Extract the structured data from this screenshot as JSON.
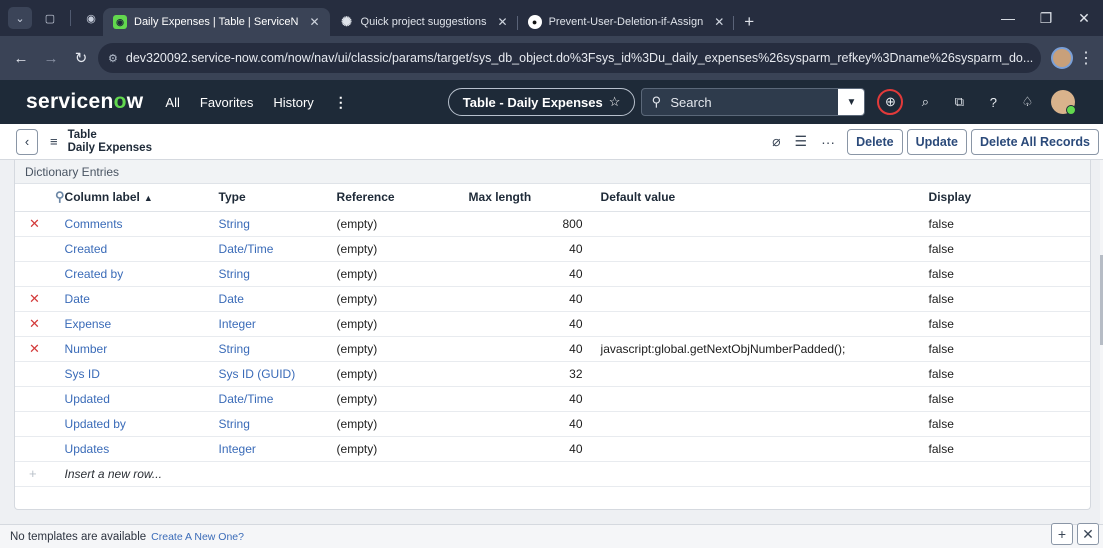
{
  "browser": {
    "tabs": [
      {
        "title": "Daily Expenses | Table | ServiceN",
        "active": true,
        "icon": "servicenow-icon"
      },
      {
        "title": "Quick project suggestions",
        "active": false,
        "icon": "chatgpt-icon"
      },
      {
        "title": "Prevent-User-Deletion-if-Assign",
        "active": false,
        "icon": "github-icon"
      }
    ],
    "new_tab": "+",
    "url": "dev320092.service-now.com/now/nav/ui/classic/params/target/sys_db_object.do%3Fsys_id%3Du_daily_expenses%26sysparm_refkey%3Dname%26sysparm_do..."
  },
  "header": {
    "logo_a": "servicen",
    "logo_o": "o",
    "logo_b": "w",
    "menu": {
      "all": "All",
      "favorites": "Favorites",
      "history": "History",
      "more": "⋮"
    },
    "context_pill": "Table - Daily Expenses",
    "search_placeholder": "Search"
  },
  "form": {
    "title_line1": "Table",
    "title_line2": "Daily Expenses",
    "buttons": {
      "delete": "Delete",
      "update": "Update",
      "delete_all": "Delete All Records"
    }
  },
  "related_list": {
    "title": "Dictionary Entries",
    "columns": {
      "label": "Column label",
      "type": "Type",
      "reference": "Reference",
      "max_length": "Max length",
      "default_value": "Default value",
      "display": "Display"
    },
    "rows": [
      {
        "deletable": true,
        "label": "Comments",
        "type": "String",
        "reference": "(empty)",
        "max_length": "800",
        "default_value": "",
        "display": "false"
      },
      {
        "deletable": false,
        "label": "Created",
        "type": "Date/Time",
        "reference": "(empty)",
        "max_length": "40",
        "default_value": "",
        "display": "false"
      },
      {
        "deletable": false,
        "label": "Created by",
        "type": "String",
        "reference": "(empty)",
        "max_length": "40",
        "default_value": "",
        "display": "false"
      },
      {
        "deletable": true,
        "label": "Date",
        "type": "Date",
        "reference": "(empty)",
        "max_length": "40",
        "default_value": "",
        "display": "false"
      },
      {
        "deletable": true,
        "label": "Expense",
        "type": "Integer",
        "reference": "(empty)",
        "max_length": "40",
        "default_value": "",
        "display": "false"
      },
      {
        "deletable": true,
        "label": "Number",
        "type": "String",
        "reference": "(empty)",
        "max_length": "40",
        "default_value": "javascript:global.getNextObjNumberPadded();",
        "display": "false"
      },
      {
        "deletable": false,
        "label": "Sys ID",
        "type": "Sys ID (GUID)",
        "reference": "(empty)",
        "max_length": "32",
        "default_value": "",
        "display": "false"
      },
      {
        "deletable": false,
        "label": "Updated",
        "type": "Date/Time",
        "reference": "(empty)",
        "max_length": "40",
        "default_value": "",
        "display": "false"
      },
      {
        "deletable": false,
        "label": "Updated by",
        "type": "String",
        "reference": "(empty)",
        "max_length": "40",
        "default_value": "",
        "display": "false"
      },
      {
        "deletable": false,
        "label": "Updates",
        "type": "Integer",
        "reference": "(empty)",
        "max_length": "40",
        "default_value": "",
        "display": "false"
      }
    ],
    "insert_row": "Insert a new row..."
  },
  "templates": {
    "message": "No templates are available",
    "create_link": "Create A New One?"
  },
  "colors": {
    "brand_green": "#62d84e",
    "header_bg": "#1e2a38",
    "link": "#3a6bb8",
    "delete_x": "#d33a3a"
  }
}
